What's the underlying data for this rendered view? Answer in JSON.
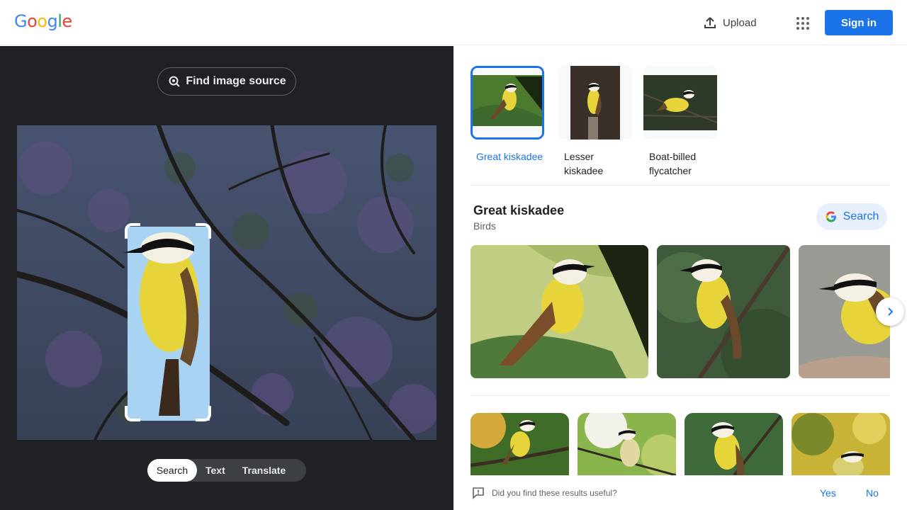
{
  "header": {
    "logo_letters": [
      "G",
      "o",
      "o",
      "g",
      "l",
      "e"
    ],
    "logo_colors": [
      "#4285f4",
      "#ea4335",
      "#fbbc05",
      "#4285f4",
      "#34a853",
      "#ea4335"
    ],
    "upload_label": "Upload",
    "signin_label": "Sign in"
  },
  "left": {
    "find_source_label": "Find image source",
    "mode_tabs": [
      {
        "label": "Search",
        "active": true
      },
      {
        "label": "Text",
        "active": false
      },
      {
        "label": "Translate",
        "active": false
      }
    ]
  },
  "right": {
    "chips": [
      {
        "label": "Great kiskadee",
        "selected": true
      },
      {
        "label": "Lesser kiskadee",
        "selected": false
      },
      {
        "label": "Boat-billed flycatcher",
        "selected": false
      }
    ],
    "entity": {
      "title": "Great kiskadee",
      "subtitle": "Birds",
      "search_label": "Search"
    },
    "feedback": {
      "question": "Did you find these results useful?",
      "yes": "Yes",
      "no": "No"
    }
  },
  "colors": {
    "accent": "#1a73e8",
    "dark_panel": "#202124",
    "bird_yellow": "#e6d43a"
  }
}
